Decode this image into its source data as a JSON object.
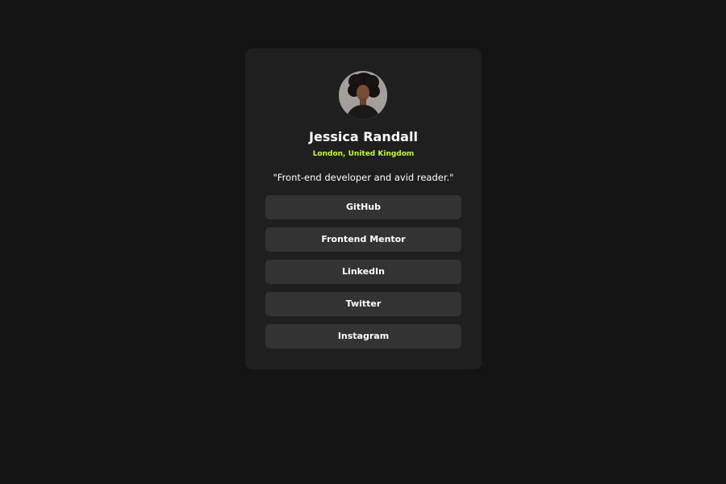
{
  "profile": {
    "name": "Jessica Randall",
    "location": "London, United Kingdom",
    "bio": "\"Front-end developer and avid reader.\""
  },
  "links": [
    {
      "label": "GitHub"
    },
    {
      "label": "Frontend Mentor"
    },
    {
      "label": "LinkedIn"
    },
    {
      "label": "Twitter"
    },
    {
      "label": "Instagram"
    }
  ],
  "colors": {
    "page_background": "#141414",
    "card_background": "#1f1f1f",
    "button_background": "#333333",
    "accent": "#c4f82a",
    "text": "#ffffff"
  }
}
